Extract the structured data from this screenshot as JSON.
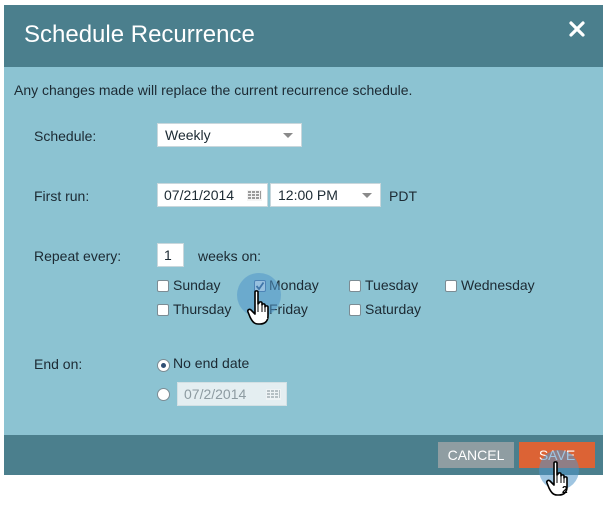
{
  "dialog": {
    "title": "Schedule Recurrence",
    "notice": "Any changes made will replace the current recurrence schedule."
  },
  "schedule": {
    "label": "Schedule:",
    "value": "Weekly"
  },
  "first_run": {
    "label": "First run:",
    "date": "07/21/2014",
    "time": "12:00 PM",
    "timezone": "PDT"
  },
  "repeat": {
    "label": "Repeat every:",
    "count": "1",
    "suffix": "weeks on:",
    "days": [
      {
        "label": "Sunday",
        "checked": false
      },
      {
        "label": "Monday",
        "checked": true
      },
      {
        "label": "Tuesday",
        "checked": false
      },
      {
        "label": "Wednesday",
        "checked": false
      },
      {
        "label": "Thursday",
        "checked": false
      },
      {
        "label": "Friday",
        "checked": false
      },
      {
        "label": "Saturday",
        "checked": false
      }
    ]
  },
  "end_on": {
    "label": "End on:",
    "no_end_label": "No end date",
    "no_end_selected": true,
    "date_value": "07/2/2014"
  },
  "buttons": {
    "cancel": "CANCEL",
    "save": "SAVE"
  },
  "step_markers": {
    "first": "1",
    "second": "2"
  },
  "colors": {
    "header": "#4b7f8d",
    "body": "#8cc3d2",
    "save": "#dc6335",
    "cancel": "#8f9da2"
  }
}
